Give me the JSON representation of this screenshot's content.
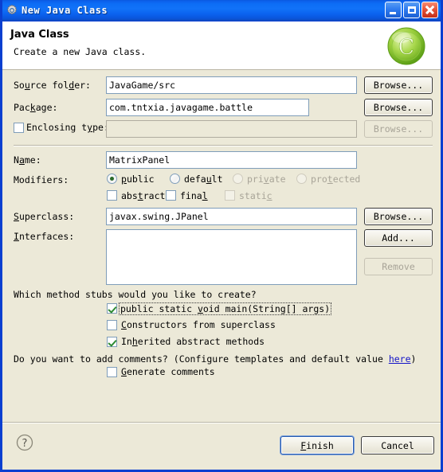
{
  "window": {
    "title": "New Java Class",
    "title_icon": "gear-icon",
    "buttons": {
      "minimize": "minimize-icon",
      "maximize": "maximize-icon",
      "close": "close-icon"
    }
  },
  "header": {
    "title": "Java Class",
    "subtitle": "Create a new Java class.",
    "logo": "java-class-wizard-logo"
  },
  "form": {
    "source_folder": {
      "label_pre": "So",
      "label_mnemonic": "u",
      "label_post": "rce fol",
      "label_mnemonic2": "d",
      "label_tail": "er:",
      "label": "Source folder:",
      "value": "JavaGame/src",
      "browse": "Browse..."
    },
    "package": {
      "label": "Package:",
      "value": "com.tntxia.javagame.battle",
      "browse": "Browse..."
    },
    "enclosing_type": {
      "label": "Enclosing type:",
      "value": "",
      "checked": false,
      "browse": "Browse...",
      "enabled": false
    },
    "name": {
      "label": "Name:",
      "value": "MatrixPanel"
    },
    "modifiers": {
      "label": "Modifiers:",
      "access": [
        {
          "label": "public",
          "checked": true,
          "enabled": true
        },
        {
          "label": "default",
          "checked": false,
          "enabled": true
        },
        {
          "label": "private",
          "checked": false,
          "enabled": false
        },
        {
          "label": "protected",
          "checked": false,
          "enabled": false
        }
      ],
      "flags": [
        {
          "label": "abstract",
          "checked": false,
          "enabled": true
        },
        {
          "label": "final",
          "checked": false,
          "enabled": true
        },
        {
          "label": "static",
          "checked": false,
          "enabled": false
        }
      ]
    },
    "superclass": {
      "label": "Superclass:",
      "value": "javax.swing.JPanel",
      "browse": "Browse..."
    },
    "interfaces": {
      "label": "Interfaces:",
      "items": [],
      "add": "Add...",
      "remove": "Remove",
      "remove_enabled": false
    },
    "method_stubs": {
      "prompt": "Which method stubs would you like to create?",
      "options": [
        {
          "label": "public static void main(String[] args)",
          "checked": true,
          "focused": true
        },
        {
          "label": "Constructors from superclass",
          "checked": false,
          "focused": false
        },
        {
          "label": "Inherited abstract methods",
          "checked": true,
          "focused": false
        }
      ]
    },
    "comments": {
      "prompt_pre": "Do you want to add comments? (Configure templates and default value ",
      "link": "here",
      "prompt_post": ")",
      "option": {
        "label": "Generate comments",
        "checked": false
      }
    }
  },
  "footer": {
    "help": "help-icon",
    "finish": "Finish",
    "cancel": "Cancel"
  }
}
